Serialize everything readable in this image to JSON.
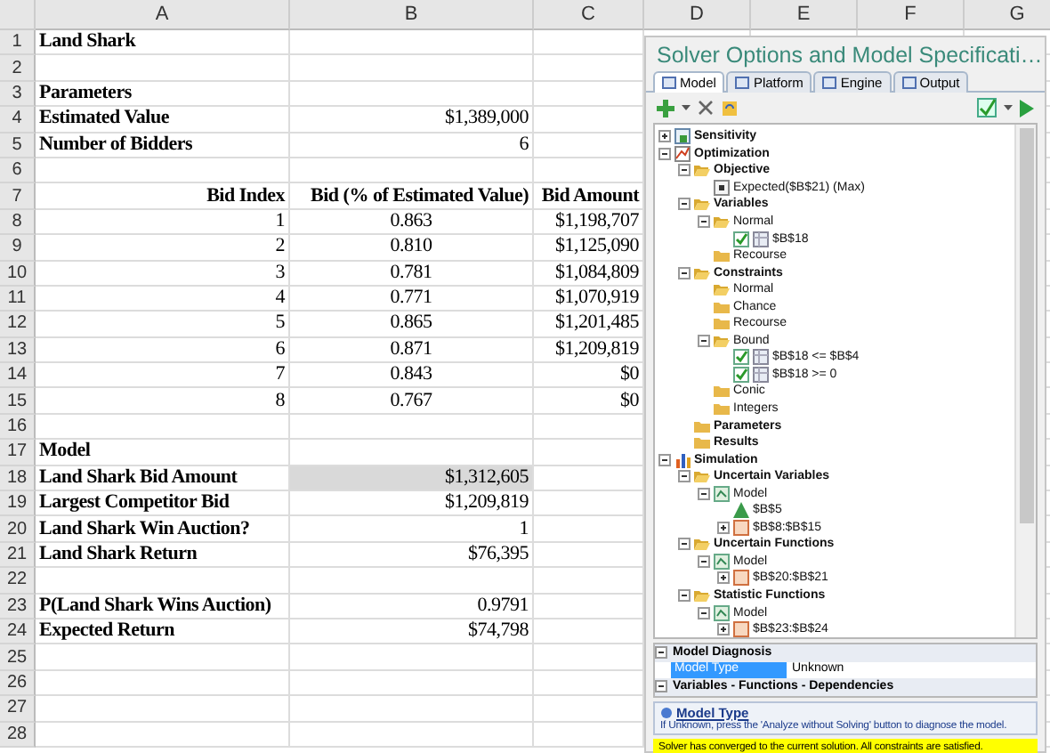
{
  "sheet": {
    "columns": [
      "A",
      "B",
      "C",
      "D",
      "E",
      "F",
      "G"
    ],
    "rows": [
      {
        "number": "1",
        "cells": [
          {
            "text": "Land Shark",
            "kind": "label"
          },
          null,
          null
        ]
      },
      {
        "number": "2",
        "cells": [
          null,
          null,
          null
        ]
      },
      {
        "number": "3",
        "cells": [
          {
            "text": "Parameters",
            "kind": "label"
          },
          null,
          null
        ]
      },
      {
        "number": "4",
        "cells": [
          {
            "text": "Estimated Value",
            "kind": "label"
          },
          {
            "text": "$1,389,000",
            "kind": "number"
          },
          null
        ]
      },
      {
        "number": "5",
        "cells": [
          {
            "text": "Number of Bidders",
            "kind": "label"
          },
          {
            "text": "6",
            "kind": "number"
          },
          null
        ]
      },
      {
        "number": "6",
        "cells": [
          null,
          null,
          null
        ]
      },
      {
        "number": "7",
        "cells": [
          {
            "text": "Bid Index",
            "kind": "header"
          },
          {
            "text": "Bid (% of Estimated Value)",
            "kind": "header"
          },
          {
            "text": "Bid Amount",
            "kind": "header"
          }
        ]
      },
      {
        "number": "8",
        "cells": [
          {
            "text": "1",
            "kind": "number"
          },
          {
            "text": "0.863",
            "kind": "center"
          },
          {
            "text": "$1,198,707",
            "kind": "number"
          }
        ]
      },
      {
        "number": "9",
        "cells": [
          {
            "text": "2",
            "kind": "number"
          },
          {
            "text": "0.810",
            "kind": "center"
          },
          {
            "text": "$1,125,090",
            "kind": "number"
          }
        ]
      },
      {
        "number": "10",
        "cells": [
          {
            "text": "3",
            "kind": "number"
          },
          {
            "text": "0.781",
            "kind": "center"
          },
          {
            "text": "$1,084,809",
            "kind": "number"
          }
        ]
      },
      {
        "number": "11",
        "cells": [
          {
            "text": "4",
            "kind": "number"
          },
          {
            "text": "0.771",
            "kind": "center"
          },
          {
            "text": "$1,070,919",
            "kind": "number"
          }
        ]
      },
      {
        "number": "12",
        "cells": [
          {
            "text": "5",
            "kind": "number"
          },
          {
            "text": "0.865",
            "kind": "center"
          },
          {
            "text": "$1,201,485",
            "kind": "number"
          }
        ]
      },
      {
        "number": "13",
        "cells": [
          {
            "text": "6",
            "kind": "number"
          },
          {
            "text": "0.871",
            "kind": "center"
          },
          {
            "text": "$1,209,819",
            "kind": "number"
          }
        ]
      },
      {
        "number": "14",
        "cells": [
          {
            "text": "7",
            "kind": "number"
          },
          {
            "text": "0.843",
            "kind": "center"
          },
          {
            "text": "$0",
            "kind": "number"
          }
        ]
      },
      {
        "number": "15",
        "cells": [
          {
            "text": "8",
            "kind": "number"
          },
          {
            "text": "0.767",
            "kind": "center"
          },
          {
            "text": "$0",
            "kind": "number"
          }
        ]
      },
      {
        "number": "16",
        "cells": [
          null,
          null,
          null
        ]
      },
      {
        "number": "17",
        "cells": [
          {
            "text": "Model",
            "kind": "label"
          },
          null,
          null
        ]
      },
      {
        "number": "18",
        "cells": [
          {
            "text": "Land Shark Bid Amount",
            "kind": "label"
          },
          {
            "text": "$1,312,605",
            "kind": "number",
            "shaded": true
          },
          null
        ]
      },
      {
        "number": "19",
        "cells": [
          {
            "text": "Largest Competitor Bid",
            "kind": "label"
          },
          {
            "text": "$1,209,819",
            "kind": "number"
          },
          null
        ]
      },
      {
        "number": "20",
        "cells": [
          {
            "text": "Land Shark Win Auction?",
            "kind": "label"
          },
          {
            "text": "1",
            "kind": "number"
          },
          null
        ]
      },
      {
        "number": "21",
        "cells": [
          {
            "text": "Land Shark Return",
            "kind": "label"
          },
          {
            "text": "$76,395",
            "kind": "number"
          },
          null
        ]
      },
      {
        "number": "22",
        "cells": [
          null,
          null,
          null
        ]
      },
      {
        "number": "23",
        "cells": [
          {
            "text": "P(Land Shark Wins Auction)",
            "kind": "label"
          },
          {
            "text": "0.9791",
            "kind": "number"
          },
          null
        ]
      },
      {
        "number": "24",
        "cells": [
          {
            "text": "Expected Return",
            "kind": "label"
          },
          {
            "text": "$74,798",
            "kind": "number"
          },
          null
        ]
      },
      {
        "number": "25",
        "cells": [
          null,
          null,
          null
        ]
      },
      {
        "number": "26",
        "cells": [
          null,
          null,
          null
        ]
      },
      {
        "number": "27",
        "cells": [
          null,
          null,
          null
        ]
      },
      {
        "number": "28",
        "cells": [
          null,
          null,
          null
        ]
      }
    ]
  },
  "panel": {
    "title": "Solver Options and Model Specificati…",
    "tabs": [
      {
        "label": "Model",
        "selected": true
      },
      {
        "label": "Platform",
        "selected": false
      },
      {
        "label": "Engine",
        "selected": false
      },
      {
        "label": "Output",
        "selected": false
      }
    ],
    "tree": [
      {
        "label": "Sensitivity",
        "kind": "sensitivity",
        "bold": true,
        "expanded": false
      },
      {
        "label": "Optimization",
        "kind": "optimization",
        "bold": true,
        "expanded": true,
        "children": [
          {
            "label": "Objective",
            "kind": "folder",
            "bold": true,
            "expanded": true,
            "children": [
              {
                "label": "Expected($B$21) (Max)",
                "kind": "objective"
              }
            ]
          },
          {
            "label": "Variables",
            "kind": "folder",
            "bold": true,
            "expanded": true,
            "children": [
              {
                "label": "Normal",
                "kind": "folder",
                "expanded": true,
                "children": [
                  {
                    "label": "$B$18",
                    "kind": "cell",
                    "checked": true
                  }
                ]
              },
              {
                "label": "Recourse",
                "kind": "folder"
              }
            ]
          },
          {
            "label": "Constraints",
            "kind": "folder",
            "bold": true,
            "expanded": true,
            "children": [
              {
                "label": "Normal",
                "kind": "folder",
                "open": true
              },
              {
                "label": "Chance",
                "kind": "folder"
              },
              {
                "label": "Recourse",
                "kind": "folder"
              },
              {
                "label": "Bound",
                "kind": "folder",
                "expanded": true,
                "children": [
                  {
                    "label": "$B$18 <= $B$4",
                    "kind": "cell",
                    "checked": true
                  },
                  {
                    "label": "$B$18 >= 0",
                    "kind": "cell",
                    "checked": true
                  }
                ]
              },
              {
                "label": "Conic",
                "kind": "folder"
              },
              {
                "label": "Integers",
                "kind": "folder"
              }
            ]
          },
          {
            "label": "Parameters",
            "kind": "folder",
            "bold": true
          },
          {
            "label": "Results",
            "kind": "folder",
            "bold": true
          }
        ]
      },
      {
        "label": "Simulation",
        "kind": "simulation",
        "bold": true,
        "expanded": true,
        "children": [
          {
            "label": "Uncertain Variables",
            "kind": "folder",
            "bold": true,
            "expanded": true,
            "children": [
              {
                "label": "Model",
                "kind": "model",
                "expanded": true,
                "children": [
                  {
                    "label": "$B$5",
                    "kind": "distribution"
                  },
                  {
                    "label": "$B$8:$B$15",
                    "kind": "range",
                    "expanded": false
                  }
                ]
              }
            ]
          },
          {
            "label": "Uncertain Functions",
            "kind": "folder",
            "bold": true,
            "expanded": true,
            "children": [
              {
                "label": "Model",
                "kind": "model",
                "expanded": true,
                "children": [
                  {
                    "label": "$B$20:$B$21",
                    "kind": "range",
                    "expanded": false
                  }
                ]
              }
            ]
          },
          {
            "label": "Statistic Functions",
            "kind": "folder",
            "bold": true,
            "expanded": true,
            "children": [
              {
                "label": "Model",
                "kind": "model",
                "expanded": true,
                "children": [
                  {
                    "label": "$B$23:$B$24",
                    "kind": "range",
                    "expanded": false
                  }
                ]
              }
            ]
          }
        ]
      }
    ],
    "properties": [
      {
        "title": "Model Diagnosis",
        "expanded": true,
        "rows": [
          {
            "name": "Model Type",
            "value": "Unknown",
            "selected": true
          }
        ]
      },
      {
        "title": "Variables - Functions - Dependencies",
        "expanded": true
      }
    ],
    "help": {
      "title": "Model Type",
      "text": "If Unknown, press the 'Analyze without Solving' button to diagnose the model."
    },
    "status": "Solver has converged to the current solution.  All constraints are satisfied."
  }
}
